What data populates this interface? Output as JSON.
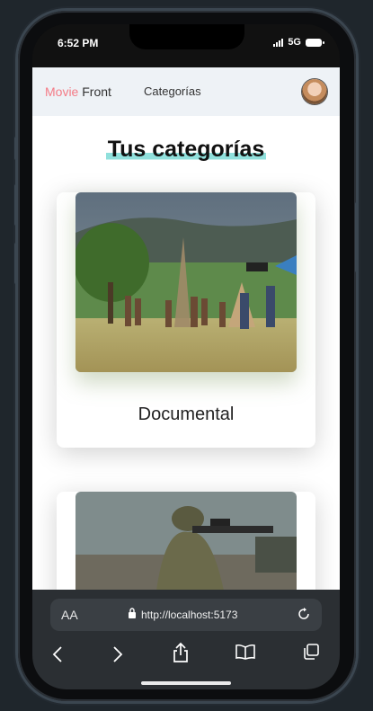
{
  "status": {
    "time": "6:52 PM",
    "network": "5G"
  },
  "navbar": {
    "brand_accent": "Movie",
    "brand_rest": " Front",
    "categories_link": "Categorías",
    "avatar_icon": "user-avatar"
  },
  "page": {
    "title": "Tus categorías"
  },
  "cards": [
    {
      "label": "Documental",
      "image": "documentary-film-set-photo"
    },
    {
      "label": "",
      "image": "soldier-with-rifle-photo"
    }
  ],
  "safari": {
    "text_size_label": "AA",
    "url": "http://localhost:5173",
    "icons": [
      "back-icon",
      "forward-icon",
      "share-icon",
      "bookmarks-icon",
      "tabs-icon",
      "reload-icon",
      "lock-icon"
    ]
  },
  "colors": {
    "accent": "#f47b86",
    "highlight": "#90e0dc",
    "navbar_bg": "#eef2f6"
  }
}
